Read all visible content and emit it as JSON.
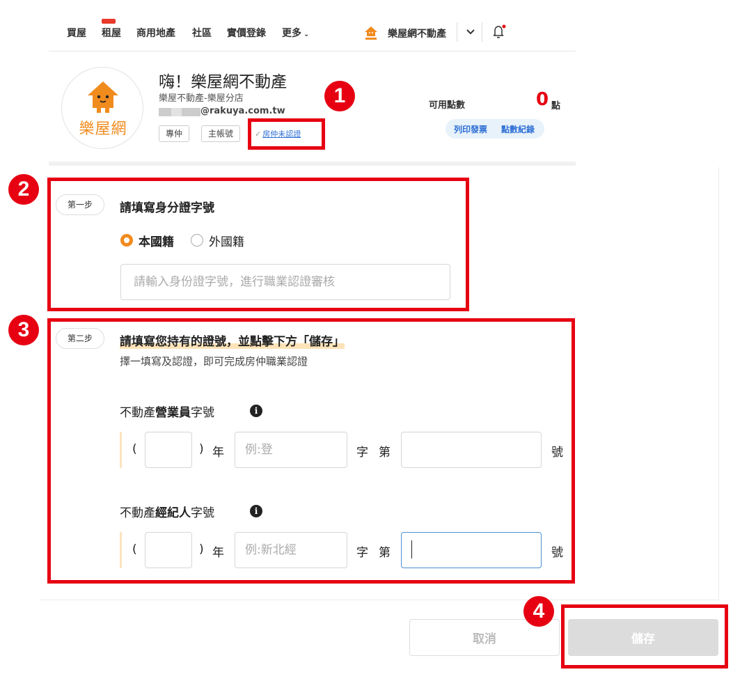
{
  "nav": {
    "items": [
      "買屋",
      "租屋",
      "商用地產",
      "社區",
      "實價登錄",
      "更多"
    ],
    "badge": "",
    "user_name": "樂屋網不動產",
    "accent": "#e8392a"
  },
  "profile": {
    "greeting": "嗨！樂屋網不動產",
    "company": "樂屋不動產-樂屋分店",
    "email_suffix": "@rakuya.com.tw",
    "avatar_text": "樂屋網",
    "tags": [
      "專仲",
      "主帳號"
    ],
    "status_link": "房仲未認證",
    "points_label": "可用點數",
    "points_value": "0",
    "points_unit": "點",
    "print_invoice": "列印發票",
    "points_record": "點數紀錄"
  },
  "step1": {
    "pill": "第一步",
    "title": "請填寫身分證字號",
    "radio_domestic": "本國籍",
    "radio_foreign": "外國籍",
    "domestic_selected": true,
    "id_placeholder": "請輸入身份證字號，進行職業認證審核"
  },
  "step2": {
    "pill": "第二步",
    "title": "請填寫您持有的證號，並點擊下方「儲存」",
    "desc": "擇一填寫及認證，即可完成房仲職業認證",
    "sales": {
      "label_prefix": "不動產",
      "label_bold": "營業員",
      "label_suffix": "字號",
      "paren_open": "(",
      "paren_close": ")",
      "year": "年",
      "char": "字",
      "di": "第",
      "number_suffix": "號",
      "type_placeholder": "例:登"
    },
    "broker": {
      "label_prefix": "不動產",
      "label_bold": "經紀人",
      "label_suffix": "字號",
      "paren_open": "(",
      "paren_close": ")",
      "year": "年",
      "char": "字",
      "di": "第",
      "number_suffix": "號",
      "type_placeholder": "例:新北經"
    }
  },
  "buttons": {
    "cancel": "取消",
    "save": "儲存"
  },
  "annotations": [
    "1",
    "2",
    "3",
    "4"
  ],
  "colors": {
    "brand_orange": "#f08b1e",
    "points_red": "#e60012",
    "link_blue": "#2e6fd4",
    "annotation_red": "#e60012"
  }
}
